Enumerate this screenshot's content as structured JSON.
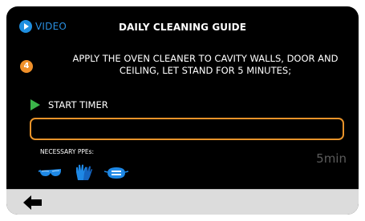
{
  "header": {
    "video_label": "VIDEO",
    "title": "DAILY CLEANING GUIDE"
  },
  "step": {
    "number": "4",
    "instruction": "APPLY THE OVEN CLEANER TO CAVITY WALLS, DOOR AND CEILING, LET STAND FOR 5 MINUTES;"
  },
  "timer": {
    "start_label": "START TIMER",
    "value": "",
    "duration": "5min"
  },
  "ppe": {
    "label": "NECESSARY PPEs:",
    "items": [
      "goggles-icon",
      "gloves-icon",
      "mask-icon"
    ]
  },
  "footer": {
    "back_icon": "arrow-left-icon"
  },
  "colors": {
    "accent_orange": "#e8932a",
    "accent_blue": "#1f8fe0",
    "play_green": "#3bb44a",
    "screen_bg": "#000000",
    "footer_bg": "#dcdcdc"
  }
}
